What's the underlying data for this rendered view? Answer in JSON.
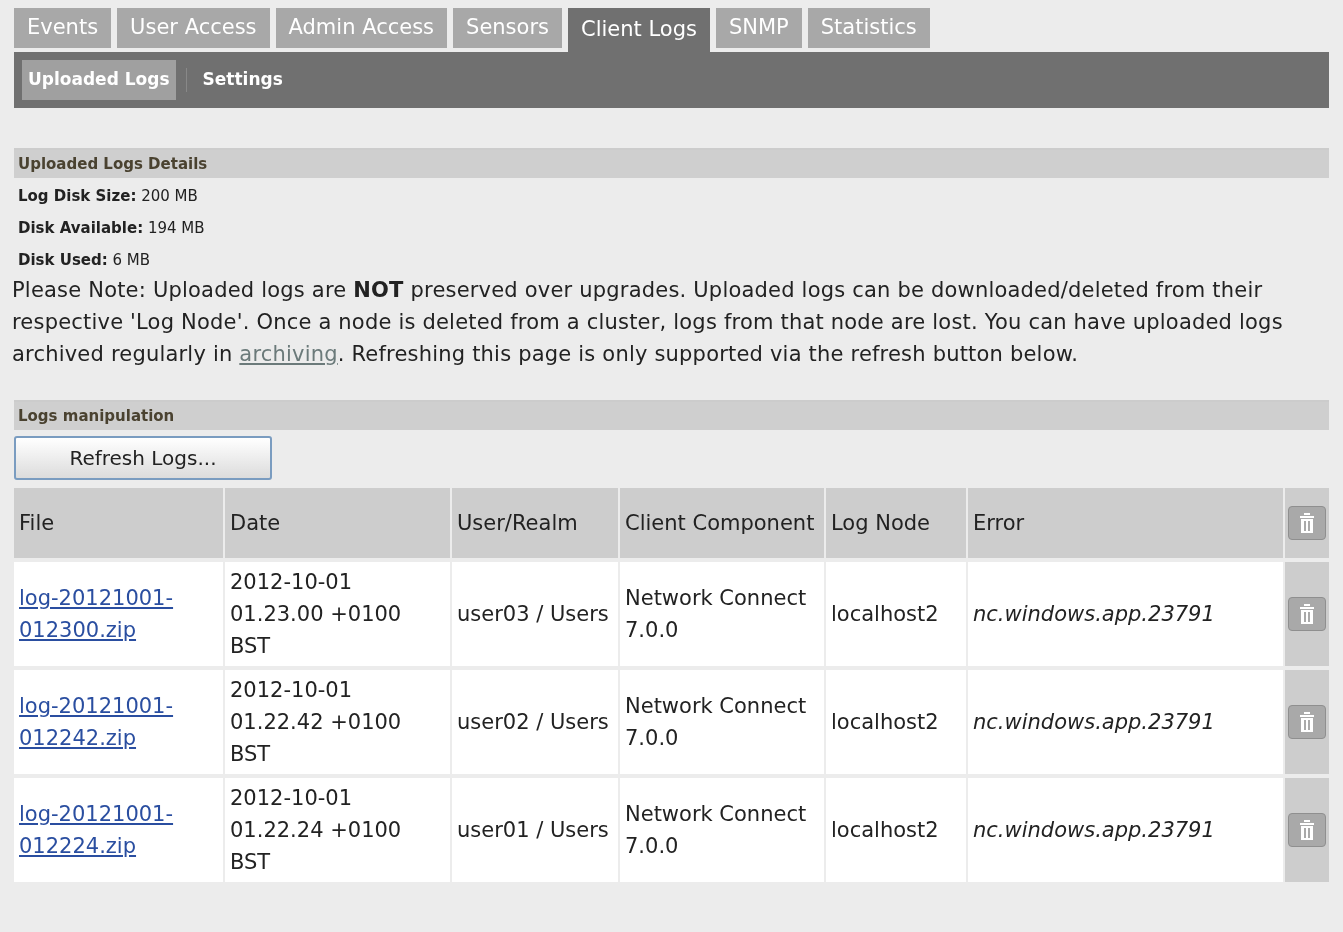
{
  "tabs": [
    {
      "label": "Events",
      "selected": false
    },
    {
      "label": "User Access",
      "selected": false
    },
    {
      "label": "Admin Access",
      "selected": false
    },
    {
      "label": "Sensors",
      "selected": false
    },
    {
      "label": "Client Logs",
      "selected": true
    },
    {
      "label": "SNMP",
      "selected": false
    },
    {
      "label": "Statistics",
      "selected": false
    }
  ],
  "subtabs": [
    {
      "label": "Uploaded Logs",
      "selected": true
    },
    {
      "label": "Settings",
      "selected": false
    }
  ],
  "details": {
    "title": "Uploaded Logs Details",
    "fields": [
      {
        "label": "Log Disk Size:",
        "value": "200 MB"
      },
      {
        "label": "Disk Available:",
        "value": "194 MB"
      },
      {
        "label": "Disk Used:",
        "value": "6 MB"
      }
    ],
    "note": {
      "before": "Please Note: Uploaded logs are **NOT** preserved over upgrades. Uploaded logs can be downloaded/deleted from their respective 'Log Node'. Once a node is deleted from a cluster, logs from that node are lost. You can have uploaded logs archived regularly in",
      "link": "archiving",
      "after": ". Refreshing this page is only supported via the refresh button below."
    }
  },
  "manipulation": {
    "title": "Logs manipulation",
    "button": "Refresh Logs..."
  },
  "table": {
    "columns": [
      "File",
      "Date",
      "User/Realm",
      "Client Component",
      "Log Node",
      "Error"
    ],
    "rows": [
      {
        "file": "log-20121001-012300.zip",
        "date": "2012-10-01 01.23.00 +0100 BST",
        "user": "user03 / Users",
        "component": "Network Connect 7.0.0",
        "node": "localhost2",
        "error": "nc.windows.app.23791"
      },
      {
        "file": "log-20121001-012242.zip",
        "date": "2012-10-01 01.22.42 +0100 BST",
        "user": "user02 / Users",
        "component": "Network Connect 7.0.0",
        "node": "localhost2",
        "error": "nc.windows.app.23791"
      },
      {
        "file": "log-20121001-012224.zip",
        "date": "2012-10-01 01.22.24 +0100 BST",
        "user": "user01 / Users",
        "component": "Network Connect 7.0.0",
        "node": "localhost2",
        "error": "nc.windows.app.23791"
      }
    ]
  }
}
